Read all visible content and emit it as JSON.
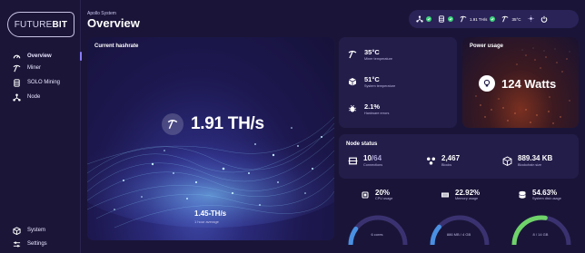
{
  "app": {
    "logo_bold": "FUTURE",
    "logo_rest": "BIT"
  },
  "sidebar": {
    "items": [
      {
        "label": "Overview",
        "icon": "gauge-icon",
        "active": true
      },
      {
        "label": "Miner",
        "icon": "pickaxe-icon"
      },
      {
        "label": "SOLO Mining",
        "icon": "database-icon"
      },
      {
        "label": "Node",
        "icon": "network-icon"
      }
    ],
    "bottom_items": [
      {
        "label": "System",
        "icon": "cube-icon"
      },
      {
        "label": "Settings",
        "icon": "sliders-icon"
      }
    ]
  },
  "header": {
    "subtitle": "Apollo System",
    "title": "Overview"
  },
  "status": {
    "hashrate": "1.91 TH/s",
    "temperature": "35°C"
  },
  "hashrate_card": {
    "title": "Current hashrate",
    "value": "1.91 TH/s",
    "average_value": "1.45 TH/s",
    "average_label": "1 hour average"
  },
  "metrics": {
    "miner_temp": {
      "value": "35°C",
      "label": "Miner temperature"
    },
    "system_temp": {
      "value": "51°C",
      "label": "System temperature"
    },
    "hw_errors": {
      "value": "2.1%",
      "label": "Hardware errors"
    }
  },
  "power": {
    "title": "Power usage",
    "value": "124 Watts"
  },
  "node": {
    "title": "Node status",
    "connections_value": "10",
    "connections_max": "/64",
    "connections_label": "Connections",
    "blocks_value": "2,467",
    "blocks_label": "Blocks",
    "size_value": "889.34 KB",
    "size_label": "Blockchain size"
  },
  "usage": {
    "cpu": {
      "value": "20%",
      "label": "CPU usage",
      "detail": "6 cores",
      "fraction": 0.2,
      "color": "#4a90e2"
    },
    "memory": {
      "value": "22.92%",
      "label": "Memory usage",
      "detail": "886 MB / 4 GB",
      "fraction": 0.2292,
      "color": "#4a90e2"
    },
    "disk": {
      "value": "54.63%",
      "label": "System disk usage",
      "detail": "8 / 14 GB",
      "fraction": 0.5463,
      "color": "#6fd36a"
    }
  },
  "colors": {
    "accent": "#8a7cff",
    "ok": "#3bd17a",
    "background": "#1a1538"
  }
}
